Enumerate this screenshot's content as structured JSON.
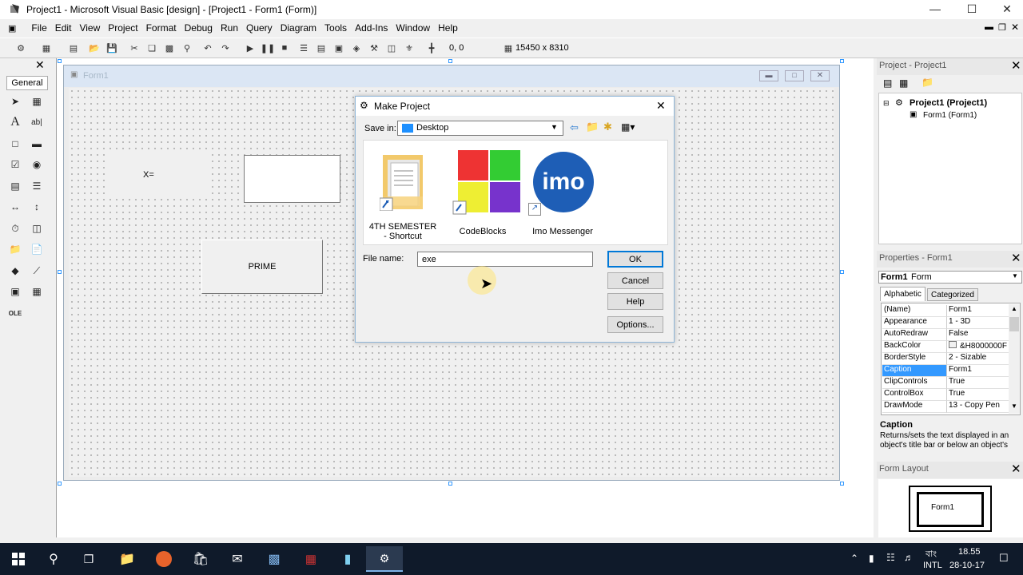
{
  "window": {
    "title": "Project1 - Microsoft Visual Basic [design] - [Project1 - Form1 (Form)]"
  },
  "menu": [
    "File",
    "Edit",
    "View",
    "Project",
    "Format",
    "Debug",
    "Run",
    "Query",
    "Diagram",
    "Tools",
    "Add-Ins",
    "Window",
    "Help"
  ],
  "toolbar": {
    "position": "0, 0",
    "size": "15450 x 8310"
  },
  "toolbox": {
    "tab": "General"
  },
  "form": {
    "title": "Form1",
    "label_text": "X=",
    "button_text": "PRIME"
  },
  "dialog": {
    "title": "Make Project",
    "save_in_label": "Save in:",
    "save_in_value": "Desktop",
    "files": [
      {
        "name": "4TH SEMESTER - Shortcut",
        "icon": "folder-shortcut-icon"
      },
      {
        "name": "CodeBlocks",
        "icon": "codeblocks-icon"
      },
      {
        "name": "Imo Messenger",
        "icon": "imo-icon"
      }
    ],
    "imo_logo": "imo",
    "file_name_label": "File name:",
    "file_name_value": "exe",
    "ok": "OK",
    "cancel": "Cancel",
    "help": "Help",
    "options": "Options..."
  },
  "project_panel": {
    "title": "Project - Project1",
    "root": "Project1 (Project1)",
    "child": "Form1 (Form1)"
  },
  "properties_panel": {
    "title": "Properties - Form1",
    "object_bold": "Form1",
    "object_type": "Form",
    "tab_alpha": "Alphabetic",
    "tab_cat": "Categorized",
    "rows": [
      {
        "k": "(Name)",
        "v": "Form1"
      },
      {
        "k": "Appearance",
        "v": "1 - 3D"
      },
      {
        "k": "AutoRedraw",
        "v": "False"
      },
      {
        "k": "BackColor",
        "v": "&H8000000F"
      },
      {
        "k": "BorderStyle",
        "v": "2 - Sizable"
      },
      {
        "k": "Caption",
        "v": "Form1"
      },
      {
        "k": "ClipControls",
        "v": "True"
      },
      {
        "k": "ControlBox",
        "v": "True"
      },
      {
        "k": "DrawMode",
        "v": "13 - Copy Pen"
      }
    ],
    "desc_title": "Caption",
    "desc_text": "Returns/sets the text displayed in an object's title bar or below an object's"
  },
  "layout_panel": {
    "title": "Form Layout",
    "form_label": "Form1"
  },
  "tray": {
    "time": "18.55",
    "date": "28-10-17",
    "lang": "INTL",
    "ime": "বাং"
  },
  "colors": {
    "accent": "#3399ff",
    "selection": "#3399ff",
    "taskbar": "#0f1a2a"
  }
}
